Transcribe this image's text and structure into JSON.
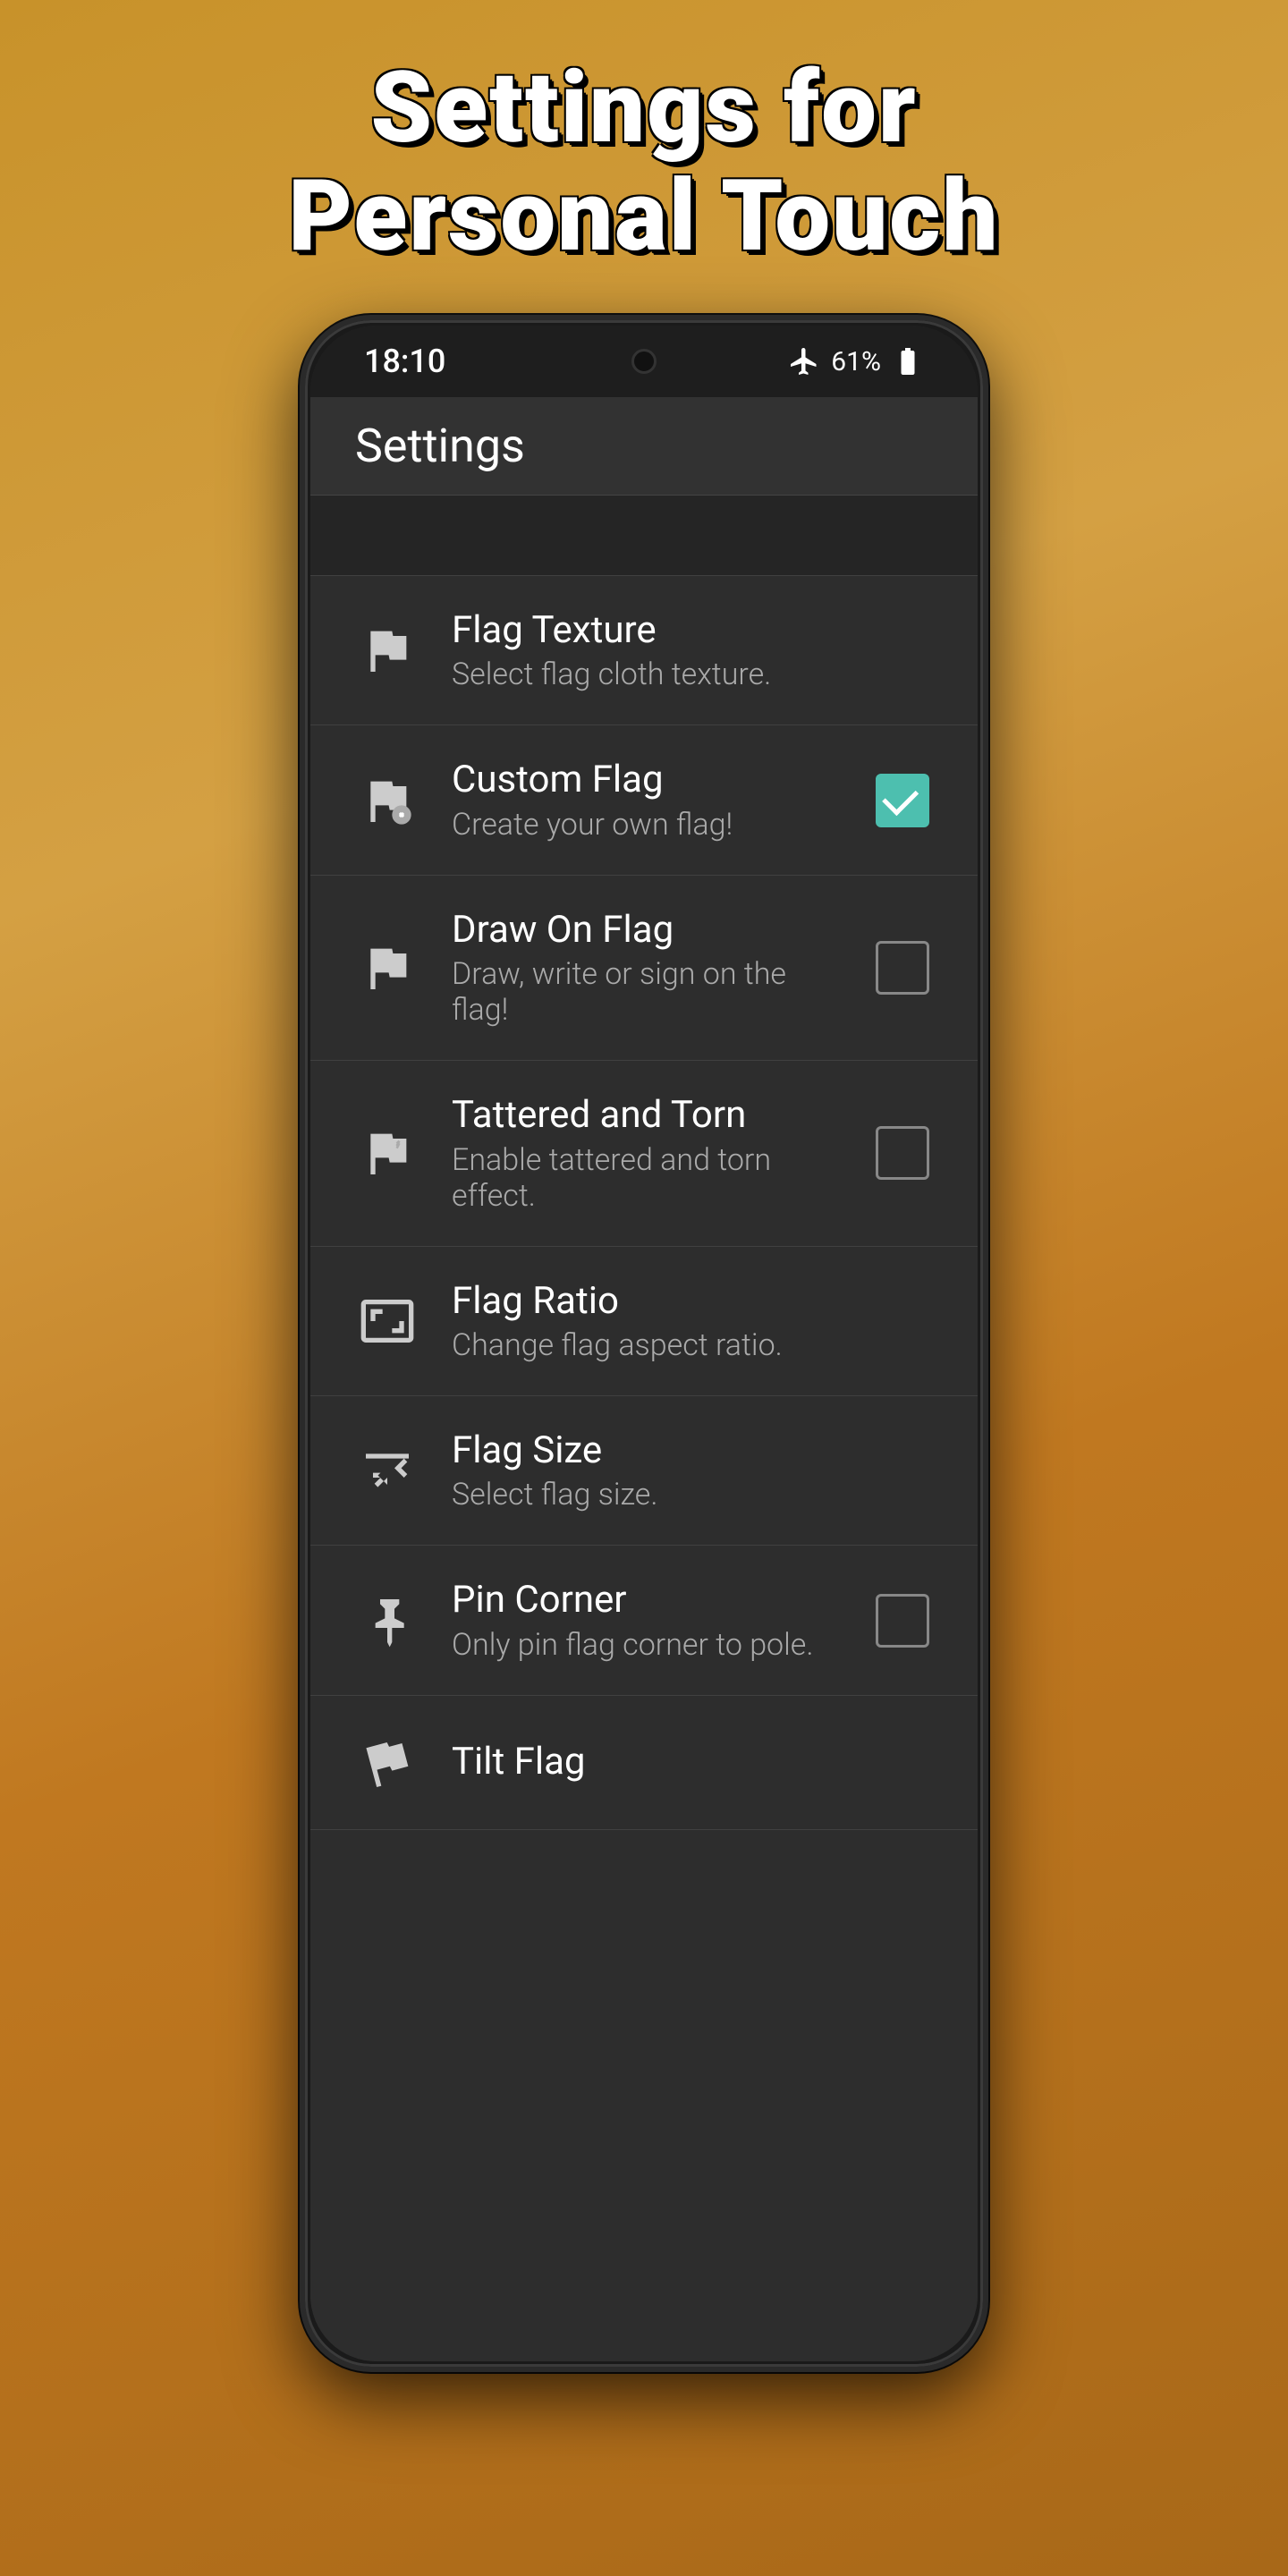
{
  "page": {
    "title_line1": "Settings for",
    "title_line2": "Personal Touch"
  },
  "status_bar": {
    "time": "18:10",
    "battery_text": "61%"
  },
  "app_bar": {
    "title": "Settings"
  },
  "settings": {
    "items": [
      {
        "id": "flag-texture",
        "title": "Flag Texture",
        "subtitle": "Select flag cloth texture.",
        "icon": "flag-texture-icon",
        "has_checkbox": false,
        "checked": false
      },
      {
        "id": "custom-flag",
        "title": "Custom Flag",
        "subtitle": "Create your own flag!",
        "icon": "custom-flag-icon",
        "has_checkbox": true,
        "checked": true
      },
      {
        "id": "draw-on-flag",
        "title": "Draw On Flag",
        "subtitle": "Draw, write or sign on the flag!",
        "icon": "draw-flag-icon",
        "has_checkbox": true,
        "checked": false
      },
      {
        "id": "tattered-torn",
        "title": "Tattered and Torn",
        "subtitle": "Enable tattered and torn effect.",
        "icon": "tattered-flag-icon",
        "has_checkbox": true,
        "checked": false
      },
      {
        "id": "flag-ratio",
        "title": "Flag Ratio",
        "subtitle": "Change flag aspect ratio.",
        "icon": "flag-ratio-icon",
        "has_checkbox": false,
        "checked": false
      },
      {
        "id": "flag-size",
        "title": "Flag Size",
        "subtitle": "Select flag size.",
        "icon": "flag-size-icon",
        "has_checkbox": false,
        "checked": false
      },
      {
        "id": "pin-corner",
        "title": "Pin Corner",
        "subtitle": "Only pin flag corner to pole.",
        "icon": "pin-corner-icon",
        "has_checkbox": true,
        "checked": false
      },
      {
        "id": "tilt-flag",
        "title": "Tilt Flag",
        "subtitle": "",
        "icon": "tilt-flag-icon",
        "has_checkbox": false,
        "checked": false
      }
    ]
  }
}
